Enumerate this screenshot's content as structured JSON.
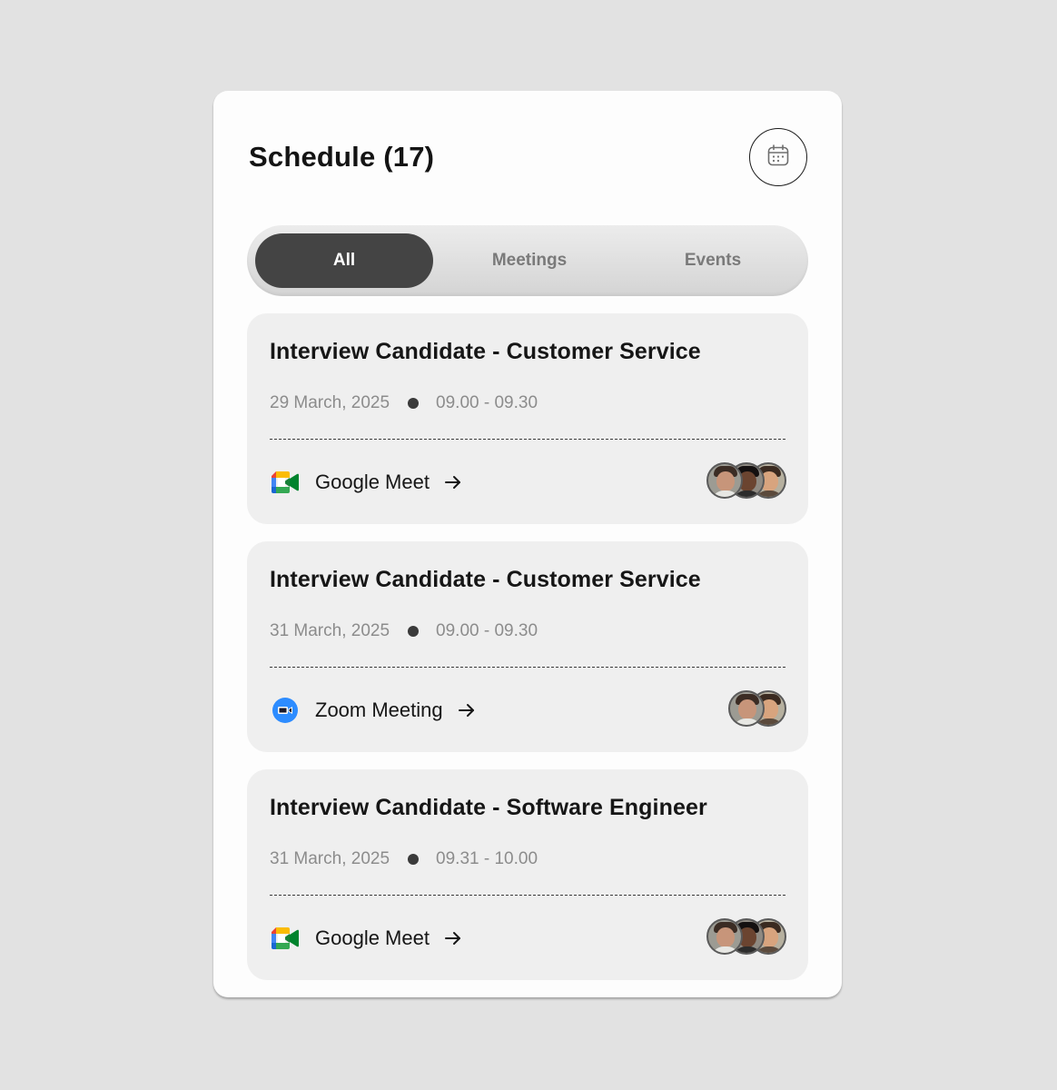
{
  "header": {
    "title": "Schedule (17)",
    "calendar_icon": "calendar-icon"
  },
  "tabs": [
    {
      "label": "All",
      "active": true
    },
    {
      "label": "Meetings",
      "active": false
    },
    {
      "label": "Events",
      "active": false
    }
  ],
  "events": [
    {
      "title": "Interview Candidate - Customer Service",
      "date": "29 March, 2025",
      "time": "09.00 - 09.30",
      "platform": "Google Meet",
      "platform_icon": "google-meet-icon",
      "attendee_count": 3
    },
    {
      "title": "Interview Candidate - Customer Service",
      "date": "31 March, 2025",
      "time": "09.00 - 09.30",
      "platform": "Zoom Meeting",
      "platform_icon": "zoom-icon",
      "attendee_count": 2
    },
    {
      "title": "Interview Candidate - Software Engineer",
      "date": "31 March, 2025",
      "time": "09.31 - 10.00",
      "platform": "Google Meet",
      "platform_icon": "google-meet-icon",
      "attendee_count": 3
    }
  ],
  "colors": {
    "background": "#e2e2e2",
    "panel": "#fdfdfd",
    "card": "#efefef",
    "active_tab": "#444444",
    "zoom_blue": "#2d8cff"
  }
}
